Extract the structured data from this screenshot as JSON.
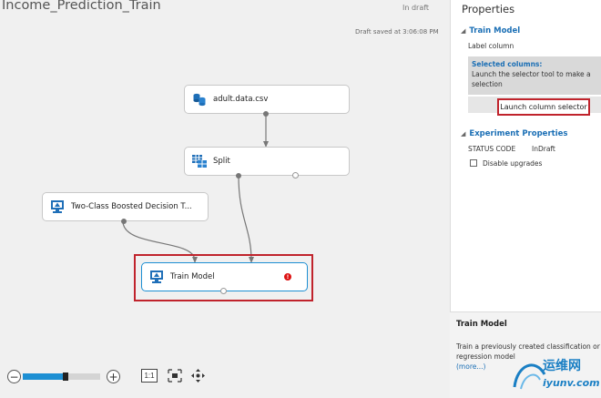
{
  "header": {
    "title": "Income_Prediction_Train",
    "status": "In draft",
    "draft_saved": "Draft saved at 3:06:08 PM"
  },
  "modules": {
    "adult": {
      "label": "adult.data.csv",
      "icon": "dataset-icon"
    },
    "split": {
      "label": "Split",
      "icon": "split-grid-icon"
    },
    "boosted": {
      "label": "Two-Class Boosted Decision T...",
      "icon": "model-monitor-icon"
    },
    "train": {
      "label": "Train Model",
      "icon": "model-monitor-icon",
      "error": "!"
    }
  },
  "zoom": {
    "minus": "−",
    "plus": "+",
    "level_fraction": 0.55,
    "actual_size": "1:1"
  },
  "properties": {
    "title": "Properties",
    "train_model": {
      "header": "Train Model",
      "label_column": "Label column",
      "selected_columns_title": "Selected columns:",
      "selected_columns_text_1": "Launch the selector tool to make a",
      "selected_columns_text_2": "selection",
      "launch_button": "Launch column selector"
    },
    "experiment": {
      "header": "Experiment Properties",
      "status_label": "STATUS CODE",
      "status_value": "InDraft",
      "disable_upgrades": "Disable upgrades"
    }
  },
  "help": {
    "title": "Train Model",
    "text_1": "Train a previously created classification or",
    "text_2": "regression model",
    "more": "(more...)"
  },
  "watermark": {
    "chinese": "运维网",
    "url": "iyunv.com"
  },
  "colors": {
    "accent": "#1b6fb5",
    "highlight": "#c0232c",
    "zoom_fill": "#1d8fd3"
  }
}
